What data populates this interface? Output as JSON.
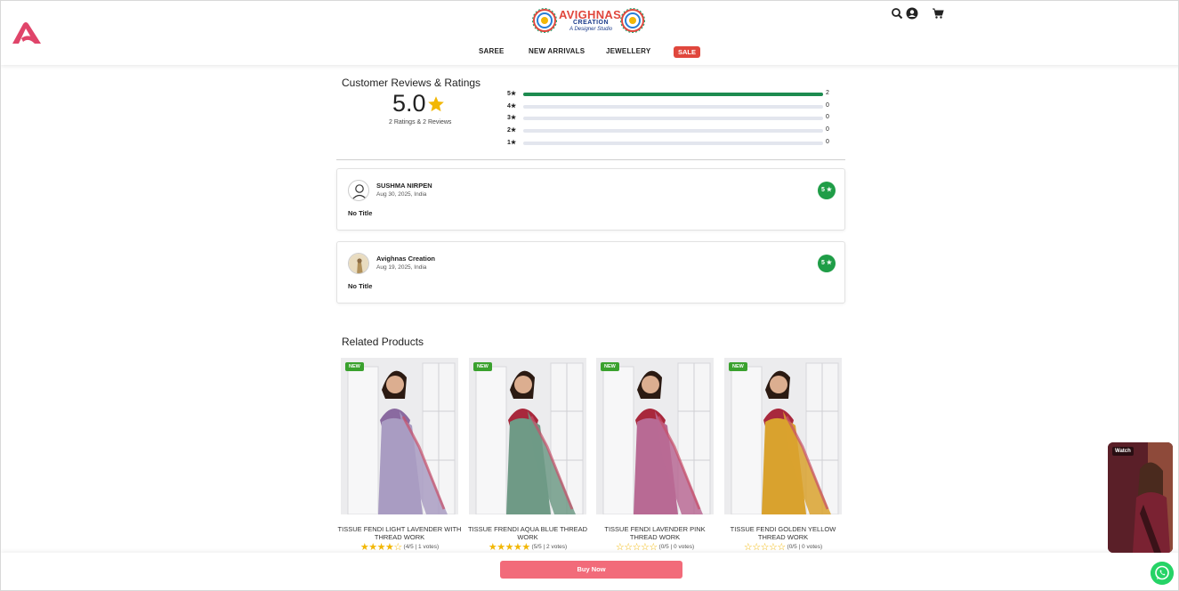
{
  "header": {
    "brand_name": "AVIGHNAS",
    "brand_sub1": "CREATION",
    "brand_sub2": "A Designer Studio",
    "nav": [
      "SAREE",
      "NEW ARRIVALS",
      "JEWELLERY"
    ],
    "sale_label": "SALE",
    "icons": [
      "search-icon",
      "account-icon",
      "cart-icon"
    ]
  },
  "reviews": {
    "title": "Customer Reviews & Ratings",
    "average": "5.0",
    "summary": "2 Ratings & 2 Reviews",
    "bars": [
      {
        "label": "5★",
        "count": "2",
        "fraction": 1.0
      },
      {
        "label": "4★",
        "count": "0",
        "fraction": 0
      },
      {
        "label": "3★",
        "count": "0",
        "fraction": 0
      },
      {
        "label": "2★",
        "count": "0",
        "fraction": 0
      },
      {
        "label": "1★",
        "count": "0",
        "fraction": 0
      }
    ],
    "items": [
      {
        "name": "SUSHMA NIRPEN",
        "date": "Aug 30, 2025, India",
        "title": "No Title",
        "badge": "5 ★"
      },
      {
        "name": "Avighnas Creation",
        "date": "Aug 19, 2025, India",
        "title": "No Title",
        "badge": "5 ★"
      }
    ]
  },
  "related": {
    "title": "Related Products",
    "badge": "NEW",
    "products": [
      {
        "name": "TISSUE FENDI LIGHT LAVENDER WITH THREAD WORK",
        "rating": 4,
        "votes": "(4/5 | 1 votes)",
        "saree": "#a99cc2",
        "blouse": "#8a6aa0"
      },
      {
        "name": "TISSUE FRENDI AQUA BLUE THREAD WORK",
        "rating": 5,
        "votes": "(5/5 | 2 votes)",
        "saree": "#6f9a86",
        "blouse": "#a8283c"
      },
      {
        "name": "TISSUE FENDI LAVENDER PINK THREAD WORK",
        "rating": 0,
        "votes": "(0/5 | 0 votes)",
        "saree": "#b86a94",
        "blouse": "#a8283c"
      },
      {
        "name": "TISSUE FENDI GOLDEN YELLOW THREAD WORK",
        "rating": 0,
        "votes": "(0/5 | 0 votes)",
        "saree": "#d9a22e",
        "blouse": "#a8283c"
      }
    ]
  },
  "footer": {
    "buy_label": "Buy Now",
    "watch_label": "Watch"
  },
  "colors": {
    "accent": "#e0473d",
    "green": "#1d8b4f",
    "buy": "#f26b7a",
    "star": "#f2b705"
  }
}
